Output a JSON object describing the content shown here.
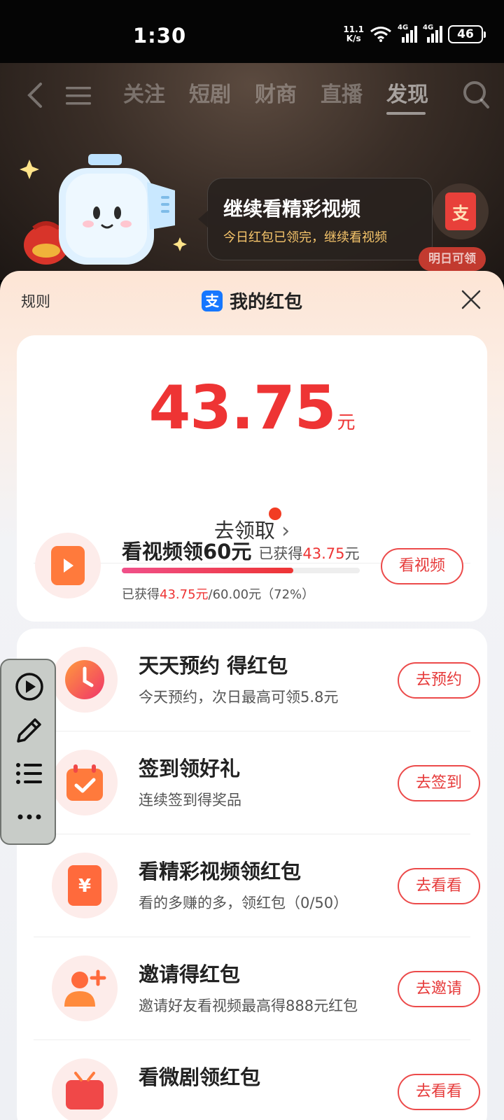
{
  "status_bar": {
    "time": "1:30",
    "net_speed_value": "11.1",
    "net_speed_unit": "K/s",
    "signal1": "4G",
    "signal2": "4G",
    "battery": "46"
  },
  "top_nav": {
    "tabs": [
      "关注",
      "短剧",
      "财商",
      "直播",
      "发现"
    ],
    "active_tab": "发现"
  },
  "bubble": {
    "title": "继续看精彩视频",
    "subtitle": "今日红包已领完，继续看视频"
  },
  "side_redpack": {
    "glyph": "支",
    "tag": "明日可领"
  },
  "sheet": {
    "rules": "规则",
    "title": "我的红包",
    "alipay_glyph": "支",
    "amount": "43.75",
    "amount_unit": "元",
    "claim_label": "去领取",
    "claim_arrow": "›"
  },
  "video_task": {
    "title": "看视频领60元",
    "earned_prefix": "已获得",
    "earned_value": "43.75",
    "earned_unit": "元",
    "progress_prefix": "已获得",
    "progress_value": "43.75元",
    "progress_rest": "/60.00元（72%）",
    "progress": 0.72,
    "button": "看视频"
  },
  "tasks": [
    {
      "title": "天天预约 得红包",
      "subtitle": "今天预约，次日最高可领5.8元",
      "button": "去预约",
      "icon": "clock-icon"
    },
    {
      "title": "签到领好礼",
      "subtitle": "连续签到得奖品",
      "button": "去签到",
      "icon": "calendar-check-icon"
    },
    {
      "title": "看精彩视频领红包",
      "subtitle": "看的多赚的多，领红包（0/50）",
      "button": "去看看",
      "icon": "yuan-envelope-icon"
    },
    {
      "title": "邀请得红包",
      "subtitle": "邀请好友看视频最高得888元红包",
      "button": "去邀请",
      "icon": "invite-user-icon"
    },
    {
      "title": "看微剧领红包",
      "subtitle": "",
      "button": "去看看",
      "icon": "tv-icon"
    }
  ],
  "colors": {
    "accent_red": "#ee3434",
    "alipay_blue": "#1677ff"
  }
}
